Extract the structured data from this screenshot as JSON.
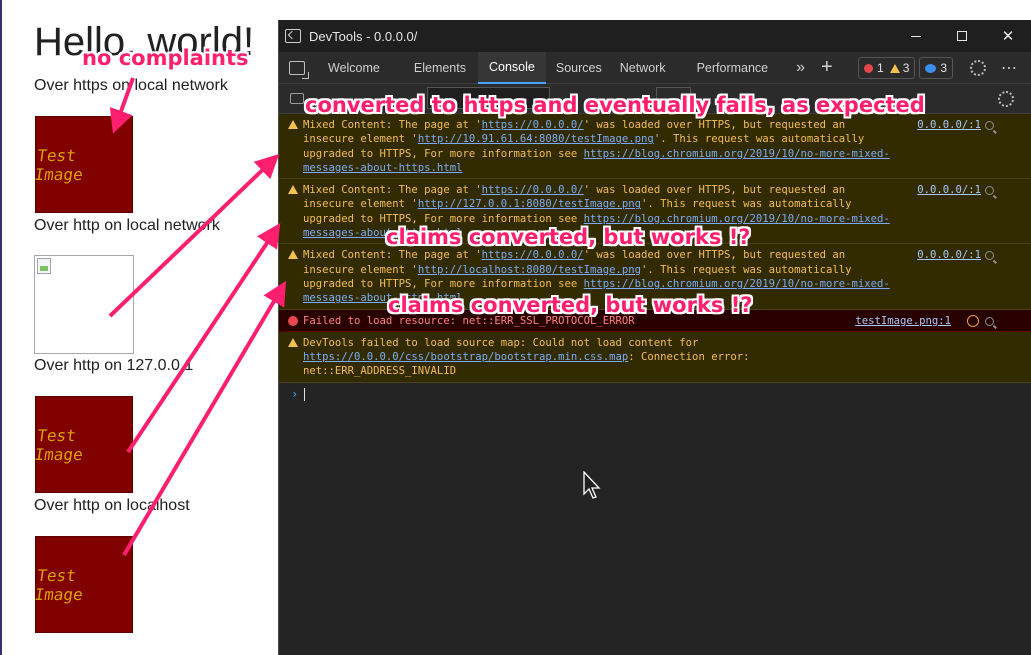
{
  "page": {
    "heading": "Hello, world!",
    "captions": [
      "Over https on local network",
      "Over http on local network",
      "Over http on 127.0.0.1",
      "Over http on localhost"
    ],
    "image_text": "Test Image"
  },
  "devtools": {
    "title": "DevTools - 0.0.0.0/",
    "tabs": [
      "Welcome",
      "Elements",
      "Console",
      "Sources",
      "Network",
      "Performance"
    ],
    "more_tabs": "»",
    "add_tab": "+",
    "counts": {
      "errors": "1",
      "warnings": "3",
      "issues": "3"
    },
    "messages": [
      {
        "type": "warn",
        "pre": "Mixed Content: The page at '",
        "page_url": "https://0.0.0.0/",
        "mid": "' was loaded over HTTPS, but requested an insecure element '",
        "element_url": "http://10.91.61.64:8080/testImage.png",
        "post": "'. This request was automatically upgraded to HTTPS, For more information see ",
        "info_url": "https://blog.chromium.org/2019/10/no-more-mixed-messages-about-https.html",
        "source": "0.0.0.0/:1"
      },
      {
        "type": "warn",
        "pre": "Mixed Content: The page at '",
        "page_url": "https://0.0.0.0/",
        "mid": "' was loaded over HTTPS, but requested an insecure element '",
        "element_url": "http://127.0.0.1:8080/testImage.png",
        "post": "'. This request was automatically upgraded to HTTPS, For more information see ",
        "info_url": "https://blog.chromium.org/2019/10/no-more-mixed-messages-about-https.html",
        "source": "0.0.0.0/:1"
      },
      {
        "type": "warn",
        "pre": "Mixed Content: The page at '",
        "page_url": "https://0.0.0.0/",
        "mid": "' was loaded over HTTPS, but requested an insecure element '",
        "element_url": "http://localhost:8080/testImage.png",
        "post": "'. This request was automatically upgraded to HTTPS, For more information see ",
        "info_url": "https://blog.chromium.org/2019/10/no-more-mixed-messages-about-https.html",
        "source": "0.0.0.0/:1"
      }
    ],
    "error_message": {
      "text": "Failed to load resource: net::ERR_SSL_PROTOCOL_ERROR",
      "source": "testImage.png:1"
    },
    "sourcemap_message": {
      "pre": "DevTools failed to load source map: Could not load content for ",
      "url": "https://0.0.0.0/css/bootstrap/bootstrap.min.css.map",
      "post": ": Connection error: net::ERR_ADDRESS_INVALID"
    },
    "prompt": "›"
  },
  "annotations": {
    "no_complaints": "no complaints",
    "converted_fails": "converted to https and eventually fails, as expected",
    "claims_1": "claims converted, but works !?",
    "claims_2": "claims converted, but works !?"
  },
  "colors": {
    "annotation": "#ff1f6e",
    "warn_text": "#f3bd54",
    "warn_bg": "#332b00",
    "image_bg": "#800000",
    "image_text": "#d9a100"
  }
}
